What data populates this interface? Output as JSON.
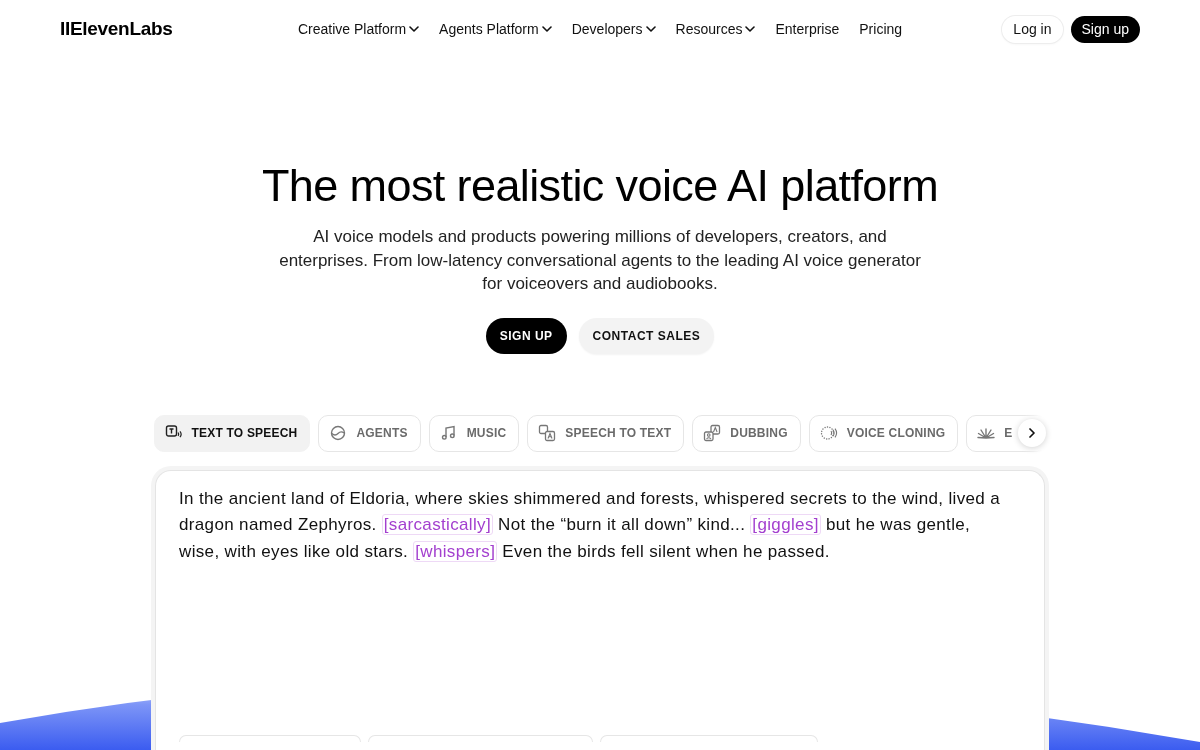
{
  "header": {
    "logo": "IIElevenLabs",
    "nav": [
      {
        "label": "Creative Platform",
        "dropdown": true
      },
      {
        "label": "Agents Platform",
        "dropdown": true
      },
      {
        "label": "Developers",
        "dropdown": true
      },
      {
        "label": "Resources",
        "dropdown": true
      },
      {
        "label": "Enterprise",
        "dropdown": false
      },
      {
        "label": "Pricing",
        "dropdown": false
      }
    ],
    "actions": [
      {
        "label": "Log in",
        "kind": "secondary"
      },
      {
        "label": "Sign up",
        "kind": "primary"
      }
    ]
  },
  "hero": {
    "title": "The most realistic voice AI platform",
    "subtitle": "AI voice models and products powering millions of developers, creators, and enterprises. From low-latency conversational agents to the leading AI voice generator for voiceovers and audiobooks.",
    "buttons": [
      {
        "label": "SIGN UP",
        "kind": "primary"
      },
      {
        "label": "CONTACT SALES",
        "kind": "secondary"
      }
    ]
  },
  "product_tabs": [
    {
      "label": "TEXT TO SPEECH",
      "selected": true
    },
    {
      "label": "AGENTS",
      "selected": false
    },
    {
      "label": "MUSIC",
      "selected": false
    },
    {
      "label": "SPEECH TO TEXT",
      "selected": false
    },
    {
      "label": "DUBBING",
      "selected": false
    },
    {
      "label": "VOICE CLONING",
      "selected": false
    },
    {
      "label": "E",
      "selected": false
    }
  ],
  "editor": {
    "segments": [
      {
        "kind": "text",
        "text": "In the ancient land of Eldoria, where skies shimmered and forests, whispered secrets to the wind, lived a dragon named Zephyros."
      },
      {
        "kind": "tag",
        "text": "[sarcastically]"
      },
      {
        "kind": "text",
        "text": "Not the “burn it all down” kind..."
      },
      {
        "kind": "tag",
        "text": "[giggles]"
      },
      {
        "kind": "text",
        "text": "but he was gentle, wise, with eyes like old stars."
      },
      {
        "kind": "tag",
        "text": "[whispers]"
      },
      {
        "kind": "text",
        "text": "Even the birds fell silent when he passed."
      }
    ]
  }
}
